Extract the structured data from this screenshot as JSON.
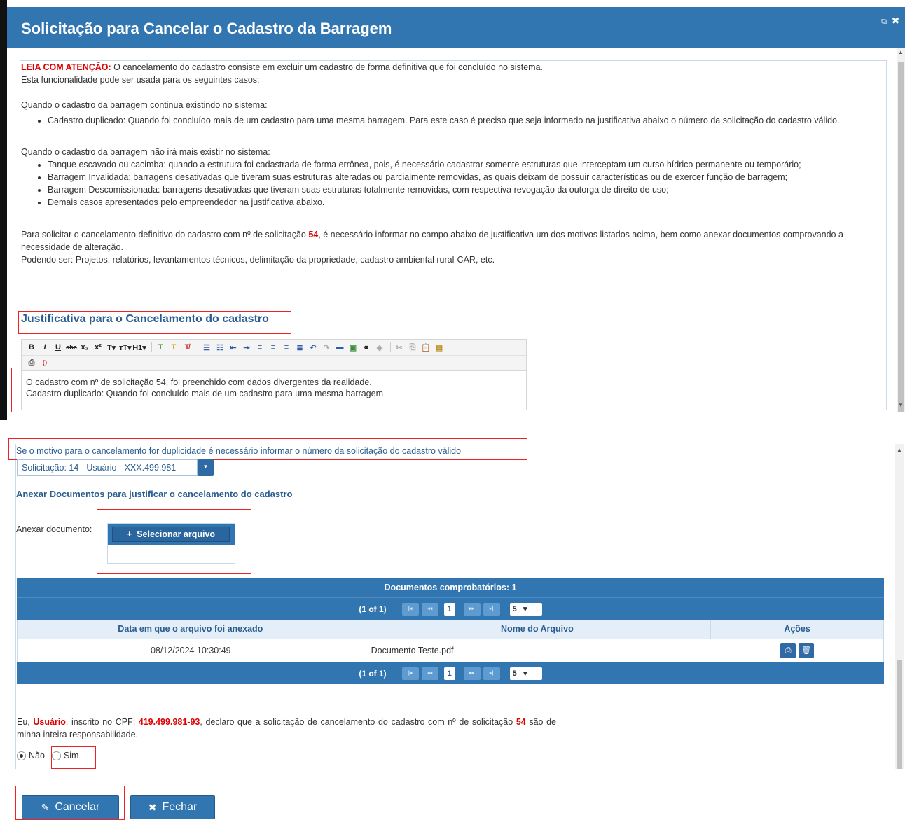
{
  "header": {
    "title": "Solicitação para Cancelar o Cadastro da Barragem",
    "icons": [
      "restore-icon",
      "close-icon"
    ]
  },
  "info": {
    "lead_bold": "LEIA COM ATENÇÃO:",
    "lead_text": " O cancelamento do cadastro consiste em excluir um cadastro de forma definitiva que foi concluído no sistema.",
    "line2": "Esta funcionalidade pode ser usada para os seguintes casos:",
    "case1_title": "Quando o cadastro da barragem continua existindo no sistema:",
    "case1_items": [
      "Cadastro duplicado: Quando foi concluído mais de um cadastro para uma mesma barragem. Para este caso é preciso que seja informado na justificativa abaixo o número da solicitação do cadastro válido."
    ],
    "case2_title": "Quando o cadastro da barragem não irá mais existir no sistema:",
    "case2_items": [
      "Tanque escavado ou cacimba: quando a estrutura foi cadastrada de forma errônea, pois, é necessário cadastrar somente estruturas que interceptam um curso hídrico permanente ou temporário;",
      "Barragem Invalidada: barragens desativadas que tiveram suas estruturas alteradas ou parcialmente removidas, as quais deixam de possuir características ou de exercer função de barragem;",
      "Barragem Descomissionada: barragens desativadas que tiveram suas estruturas totalmente removidas, com respectiva revogação da outorga de direito de uso;",
      "Demais casos apresentados pelo empreendedor na justificativa abaixo."
    ],
    "para_a": "Para solicitar o cancelamento definitivo do cadastro com nº de solicitação ",
    "para_num": "54",
    "para_b": ", é necessário informar no campo abaixo de justificativa um dos motivos listados acima, bem como anexar documentos comprovando a necessidade de alteração.",
    "para2": "Podendo ser: Projetos, relatórios, levantamentos técnicos, delimitação da propriedade, cadastro ambiental rural-CAR, etc."
  },
  "justificativa": {
    "title": "Justificativa para o Cancelamento do cadastro",
    "editor_line1": "O cadastro com nº de solicitação 54, foi preenchido com dados divergentes da realidade.",
    "editor_line2": "Cadastro duplicado: Quando foi concluído mais de um cadastro para uma mesma barragem"
  },
  "duplicidade": {
    "note": "Se o motivo para o cancelamento for duplicidade é necessário informar o número da solicitação do cadastro válido",
    "select_value": "Solicitação: 14 - Usuário - XXX.499.981-"
  },
  "anexar": {
    "title": "Anexar Documentos para justificar o cancelamento do cadastro",
    "label": "Anexar documento:",
    "button": "Selecionar arquivo"
  },
  "table": {
    "caption": "Documentos comprobatórios: 1",
    "pager_label": "(1 of 1)",
    "page": "1",
    "page_size": "5",
    "columns": [
      "Data em que o arquivo foi anexado",
      "Nome do Arquivo",
      "Ações"
    ],
    "rows": [
      {
        "date": "08/12/2024 10:30:49",
        "file": "Documento Teste.pdf"
      }
    ]
  },
  "declaracao": {
    "t1": "Eu, ",
    "user": "Usuário",
    "t2": ", inscrito no CPF: ",
    "cpf": "419.499.981-93",
    "t3": ", declaro que a solicitação de cancelamento do cadastro com nº de solicitação ",
    "num": "54",
    "t4": " são de minha inteira responsabilidade."
  },
  "radios": {
    "nao": "Não",
    "sim": "Sim",
    "selected": "Não"
  },
  "buttons": {
    "cancelar": "Cancelar",
    "fechar": "Fechar"
  },
  "colors": {
    "header": "#3176b0",
    "accent_red": "#e00000",
    "title_blue": "#2a5d8f"
  }
}
